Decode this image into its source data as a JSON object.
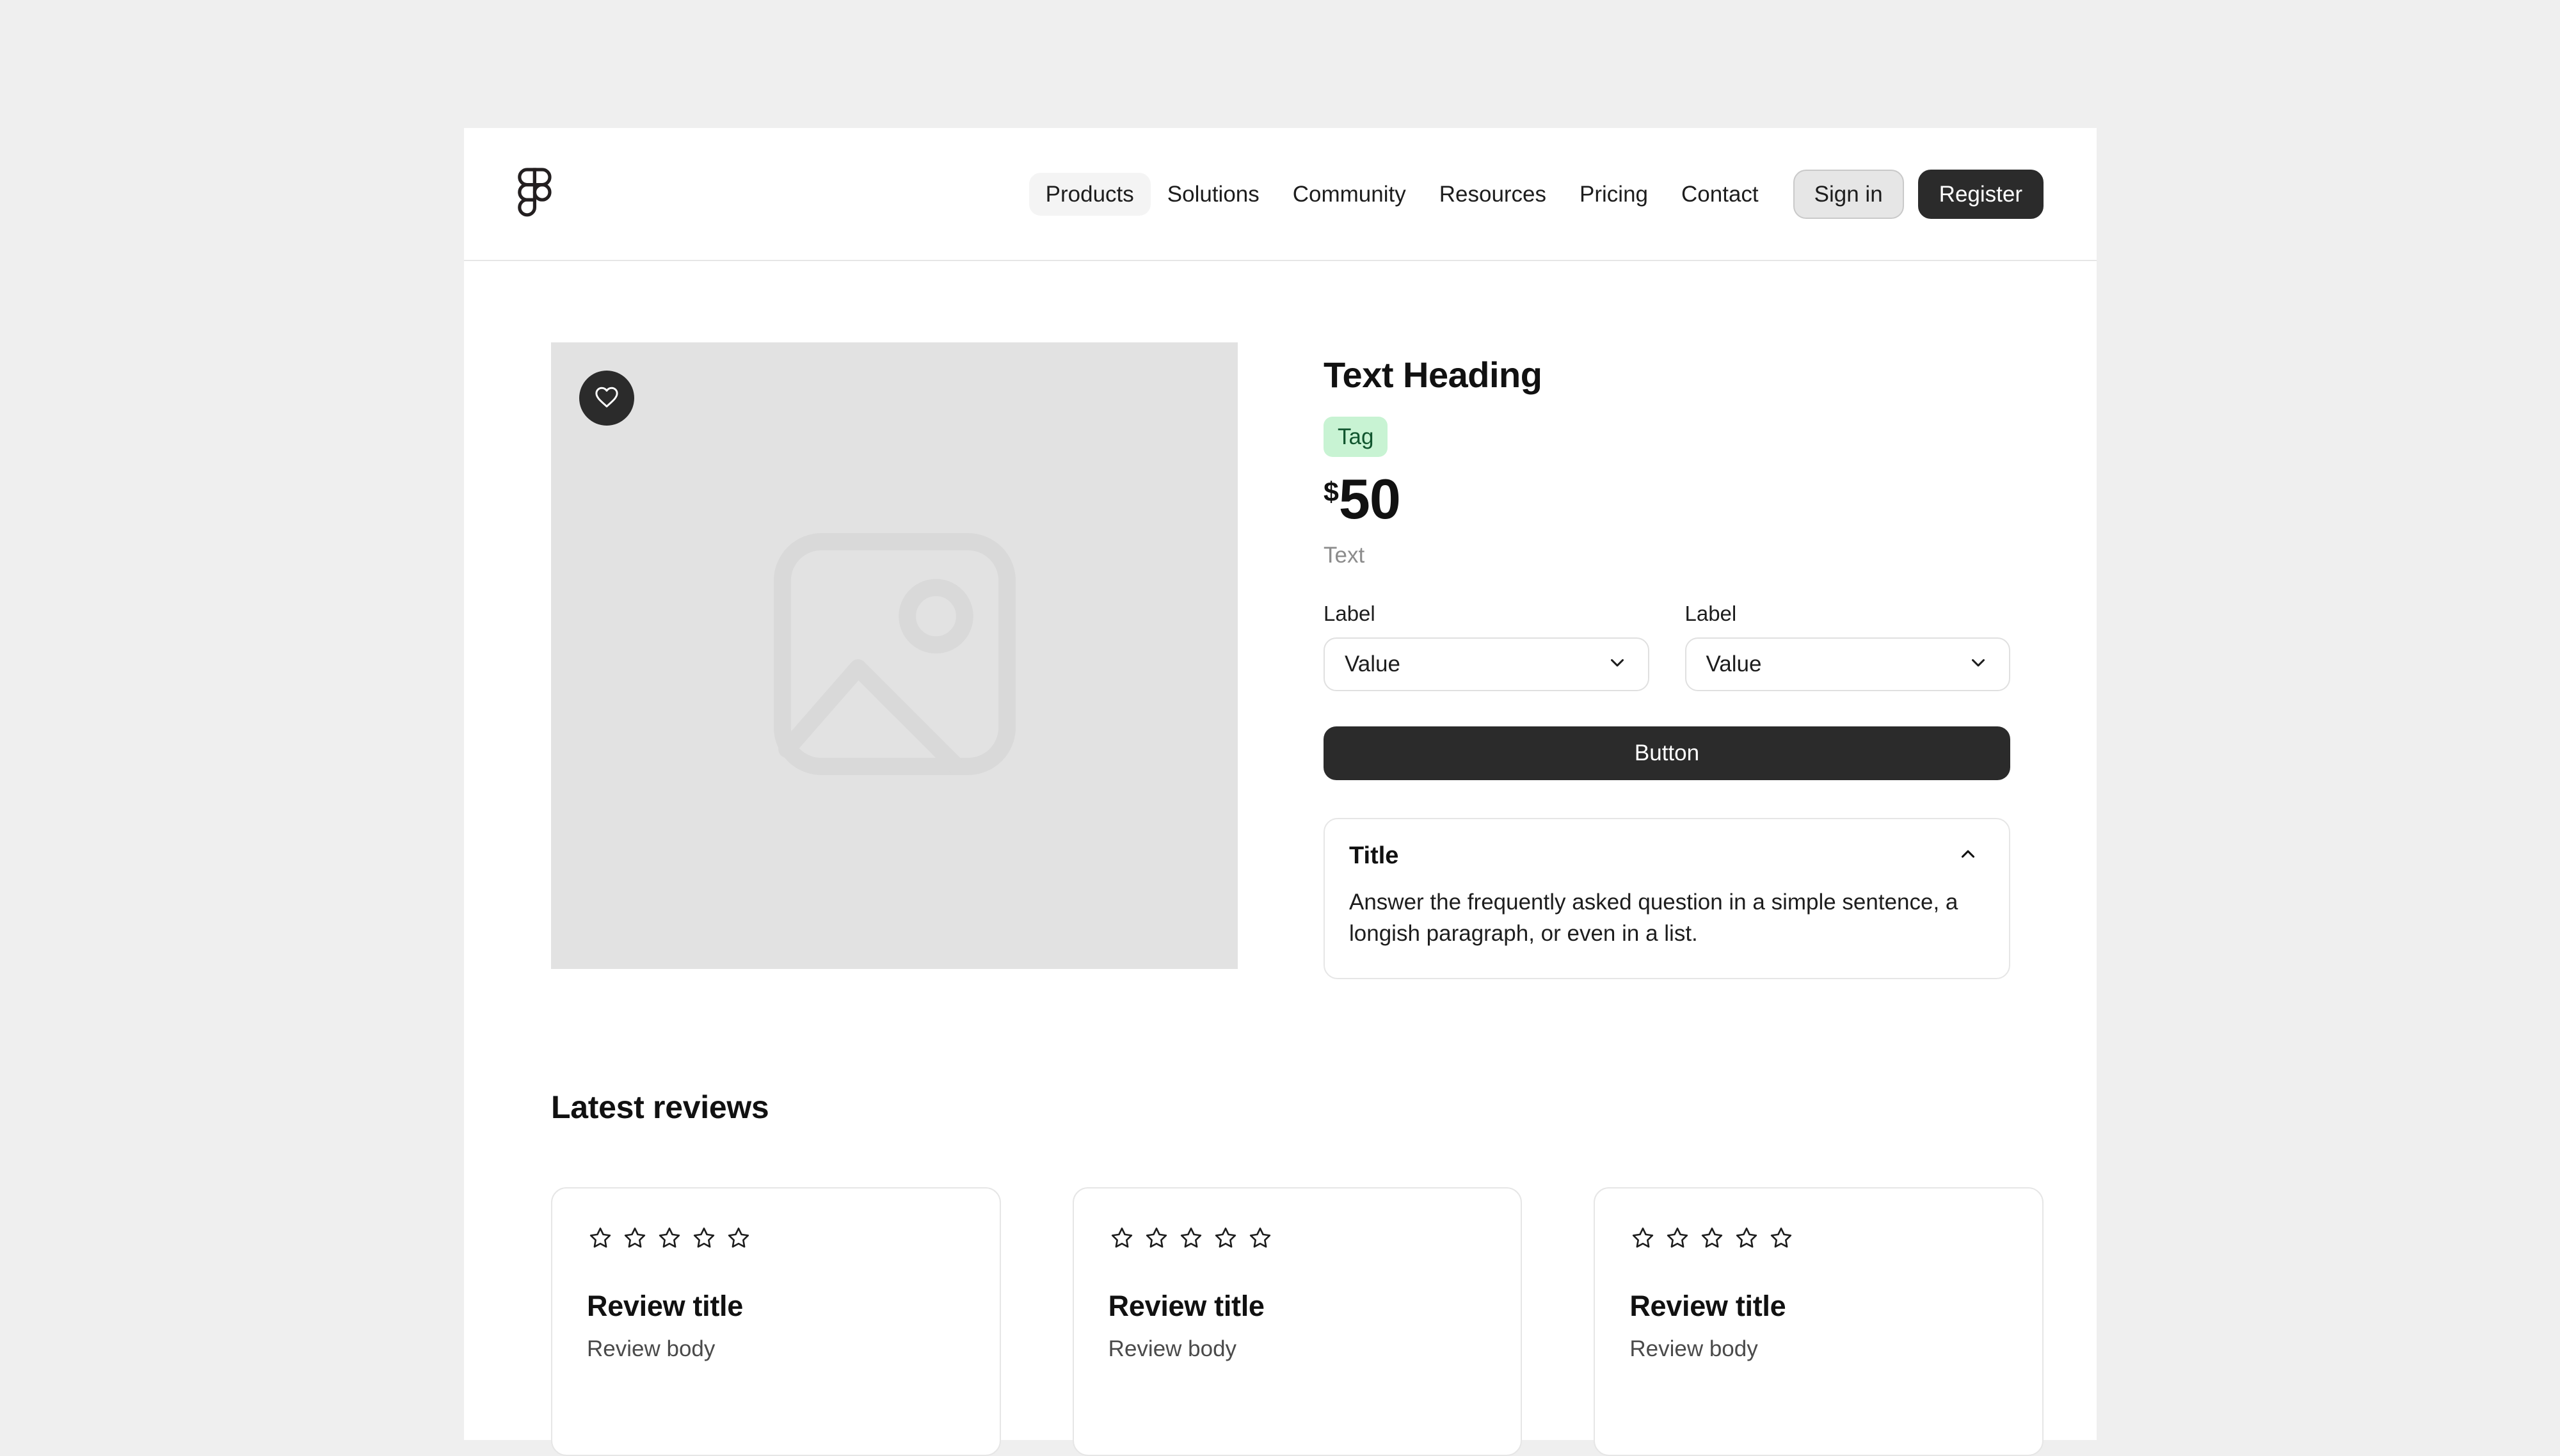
{
  "header": {
    "logo_icon": "figma-logo-icon",
    "nav_items": [
      {
        "label": "Products",
        "active": true
      },
      {
        "label": "Solutions",
        "active": false
      },
      {
        "label": "Community",
        "active": false
      },
      {
        "label": "Resources",
        "active": false
      },
      {
        "label": "Pricing",
        "active": false
      },
      {
        "label": "Contact",
        "active": false
      }
    ],
    "signin_label": "Sign in",
    "register_label": "Register"
  },
  "product": {
    "favorite_icon": "heart-icon",
    "image_placeholder_icon": "image-placeholder-icon",
    "heading": "Text Heading",
    "tag": "Tag",
    "price_currency": "$",
    "price_amount": "50",
    "subtext": "Text",
    "selects": [
      {
        "label": "Label",
        "value": "Value",
        "chevron_icon": "chevron-down-icon"
      },
      {
        "label": "Label",
        "value": "Value",
        "chevron_icon": "chevron-down-icon"
      }
    ],
    "button_label": "Button",
    "accordion": {
      "title": "Title",
      "chevron_icon": "chevron-up-icon",
      "body": "Answer the frequently asked question in a simple sentence, a longish paragraph, or even in a list."
    }
  },
  "reviews": {
    "heading": "Latest reviews",
    "star_icon": "star-outline-icon",
    "stars_per_card": 5,
    "cards": [
      {
        "title": "Review title",
        "body": "Review body",
        "rating": 0
      },
      {
        "title": "Review title",
        "body": "Review body",
        "rating": 0
      },
      {
        "title": "Review title",
        "body": "Review body",
        "rating": 0
      }
    ]
  },
  "colors": {
    "page_background": "#efefef",
    "canvas": "#ffffff",
    "dark": "#2b2b2b",
    "border": "#e6e6e6",
    "tag_background": "#c8f3d3",
    "tag_text": "#11562f",
    "placeholder_fill": "#e2e2e2",
    "muted_text": "#8c8c8c"
  }
}
